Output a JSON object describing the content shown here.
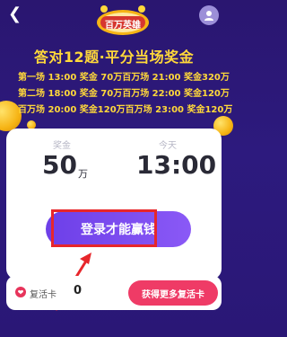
{
  "header": {
    "logo_text": "百万英雄",
    "logo_sub": "百万"
  },
  "headline": "答对12题·平分当场奖金",
  "schedule": [
    {
      "left": "第一场 13:00 奖金 70万",
      "right": "百万场 21:00 奖金320万"
    },
    {
      "left": "第二场 18:00 奖金 70万",
      "right": "百万场 22:00 奖金120万"
    },
    {
      "left": "百万场 20:00 奖金120万",
      "right": "百万场 23:00 奖金120万"
    }
  ],
  "card": {
    "prize_label": "奖金",
    "prize_value": "50",
    "prize_unit": "万",
    "time_label": "今天",
    "time_value": "13:00",
    "login_label": "登录才能赢钱"
  },
  "bottom": {
    "revive_label": "复活卡",
    "revive_count": "0",
    "more_label": "获得更多复活卡"
  },
  "colors": {
    "bg": "#2a1670",
    "gold": "#ffd83a",
    "accent": "#7b4cf0",
    "red": "#ef3b66"
  }
}
